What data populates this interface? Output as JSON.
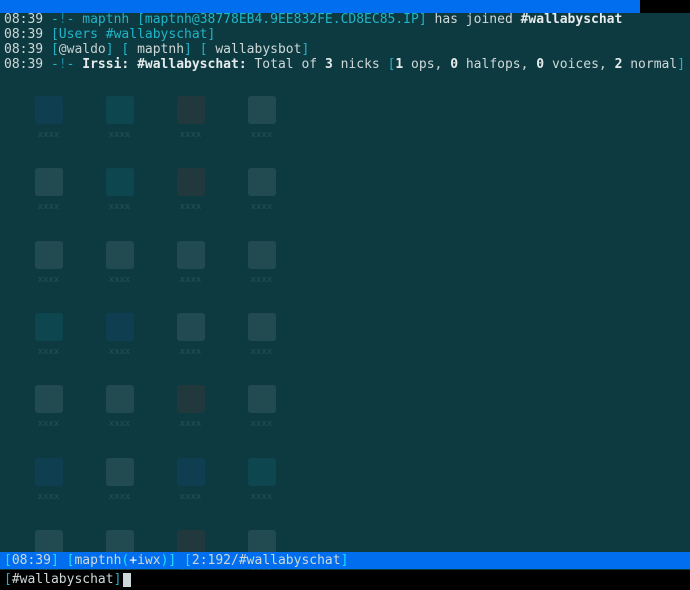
{
  "topbar": {
    "time": ""
  },
  "lines": {
    "l1": {
      "ts": "08:39",
      "nick": "maptnh",
      "host": "maptnh@38778EB4.9EE832FE.CD8EC85.IP",
      "verb": " has joined ",
      "chan": "#wallabyschat"
    },
    "l2": {
      "ts": "08:39",
      "label": "Users",
      "chan": "#wallabyschat"
    },
    "l3": {
      "ts": "08:39",
      "op": "@waldo",
      "n2": "maptnh",
      "n3": "wallabysbot"
    },
    "l4": {
      "ts": "08:39",
      "prefix": "Irssi: #wallabyschat:",
      "t1": " Total of ",
      "v1": "3",
      "t2": " nicks ",
      "v2": "1",
      "t3": " ops, ",
      "v3": "0",
      "t4": " halfops, ",
      "v4": "0",
      "t5": " voices, ",
      "v5": "2",
      "t6": " normal"
    }
  },
  "status": {
    "time": "08:39",
    "nick": "maptnh",
    "flag": "i",
    "mode": "wx",
    "pos": "2:192",
    "chan": "#wallabyschat"
  },
  "input": {
    "chan": "#wallabyschat"
  }
}
